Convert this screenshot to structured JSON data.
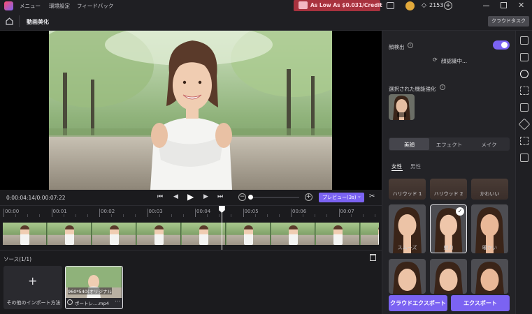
{
  "titlebar": {
    "menus": [
      "メニュー",
      "環境設定",
      "フィードバック"
    ],
    "promo": "As Low As $0.031/Credit",
    "credits": "2153"
  },
  "toolbar": {
    "page_title": "動画美化",
    "cloud_task": "クラウドタスク"
  },
  "playback": {
    "timecode": "0:00:04:14/0:00:07:22",
    "preview_label": "プレビュー(3s)"
  },
  "timeline": {
    "ticks": [
      "00:00",
      "00:01",
      "00:02",
      "00:03",
      "00:04",
      "00:05",
      "00:06",
      "00:07"
    ],
    "playhead_fraction": 0.6
  },
  "source": {
    "header": "ソース(1/1)",
    "import_label": "その他のインポート方法",
    "clip_resolution": "960*540(オリジナル",
    "clip_name": "ポートレ....mp4"
  },
  "panel": {
    "face_detect_label": "顔検出",
    "recognizing": "顔認識中...",
    "selected_label": "選択された機能強化",
    "tabs": [
      "美顔",
      "エフェクト",
      "メイク"
    ],
    "active_tab": "美顔",
    "gender_tabs": [
      "女性",
      "男性"
    ],
    "row1_labels": [
      "ハリウッド 1",
      "ハリウッド 2",
      "かわいい"
    ],
    "row2_labels": [
      "スムーズ",
      "魅力",
      "暖かい"
    ],
    "export_cloud": "クラウドエクスポート",
    "export": "エクスポート"
  },
  "colors": {
    "accent": "#7b63f2",
    "promo_bg": "#a8323e"
  }
}
